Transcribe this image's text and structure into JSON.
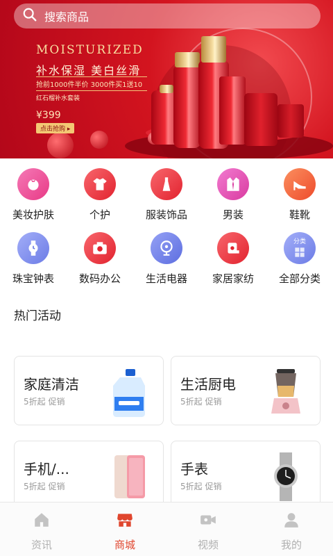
{
  "search": {
    "placeholder": "搜索商品"
  },
  "banner": {
    "title": "MOISTURIZED",
    "subtitle": "补水保湿 美白丝滑",
    "promo": "抢前1000件半价 3000件买1送10",
    "set_name": "红石榴补水套装",
    "price": "¥399",
    "cta": "点击抢购 ▸"
  },
  "categories": [
    {
      "label": "美妆护肤",
      "icon": "tomato-icon",
      "color": "#ee4d93"
    },
    {
      "label": "个护",
      "icon": "shirt-icon",
      "color": "#ee3d45"
    },
    {
      "label": "服装饰品",
      "icon": "dress-icon",
      "color": "#ee3d45"
    },
    {
      "label": "男装",
      "icon": "suit-icon",
      "color": "#e84cb0"
    },
    {
      "label": "鞋靴",
      "icon": "heel-icon",
      "color": "#f2623a"
    },
    {
      "label": "珠宝钟表",
      "icon": "watch-icon",
      "color": "#7f8ef2"
    },
    {
      "label": "数码办公",
      "icon": "camera-icon",
      "color": "#ee3d45"
    },
    {
      "label": "生活电器",
      "icon": "fan-icon",
      "color": "#6f7ee8"
    },
    {
      "label": "家居家纺",
      "icon": "tissue-roll-icon",
      "color": "#ee3d45"
    },
    {
      "label": "全部分类",
      "icon": "all-categories-icon",
      "color": "#7f8ef2",
      "badge": "分类"
    }
  ],
  "section": {
    "title": "热门活动"
  },
  "cards": [
    {
      "title": "家庭清洁",
      "subtitle": "5折起 促销",
      "image": "detergent-bottle"
    },
    {
      "title": "生活厨电",
      "subtitle": "5折起 促销",
      "image": "blender"
    },
    {
      "title": "手机/...",
      "subtitle": "5折起 促销",
      "image": "smartphone"
    },
    {
      "title": "手表",
      "subtitle": "5折起 促销",
      "image": "wristwatch"
    }
  ],
  "tabs": [
    {
      "label": "资讯",
      "icon": "home-icon",
      "active": false
    },
    {
      "label": "商城",
      "icon": "shop-icon",
      "active": true
    },
    {
      "label": "视频",
      "icon": "video-icon",
      "active": false
    },
    {
      "label": "我的",
      "icon": "user-icon",
      "active": false
    }
  ],
  "colors": {
    "accent": "#e0462e",
    "inactive": "#b0b0b0",
    "banner": "#d3141f"
  }
}
